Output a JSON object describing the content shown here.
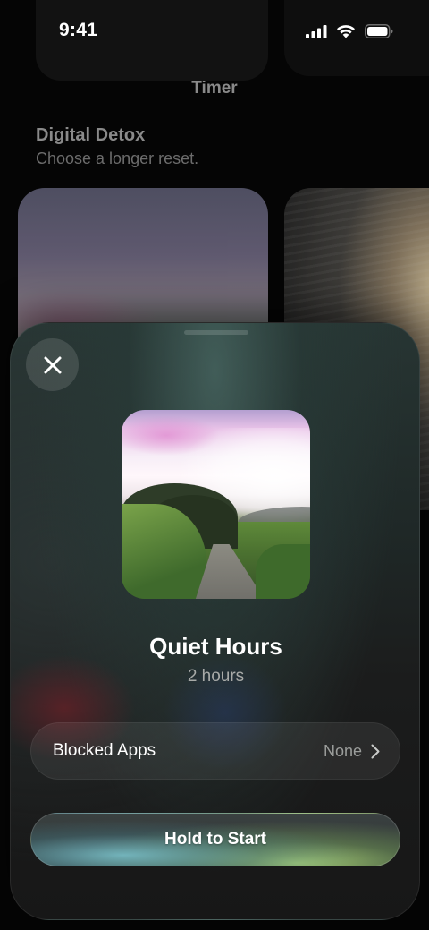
{
  "status_bar": {
    "time": "9:41"
  },
  "background": {
    "title": "Timer",
    "section_title": "Digital Detox",
    "section_subtitle": "Choose a longer reset."
  },
  "sheet": {
    "title": "Quiet Hours",
    "subtitle": "2 hours",
    "blocked_apps": {
      "label": "Blocked Apps",
      "value": "None"
    },
    "primary_button": {
      "label": "Hold to Start"
    },
    "icons": {
      "close": "close-icon",
      "chevron": "chevron-right-icon"
    }
  },
  "colors": {
    "sheet_top": "#273533",
    "sheet_bottom": "#171717",
    "button_glow_teal": "#78bec8",
    "button_glow_green": "#aad278",
    "secondary_text": "#a8aaa8"
  }
}
